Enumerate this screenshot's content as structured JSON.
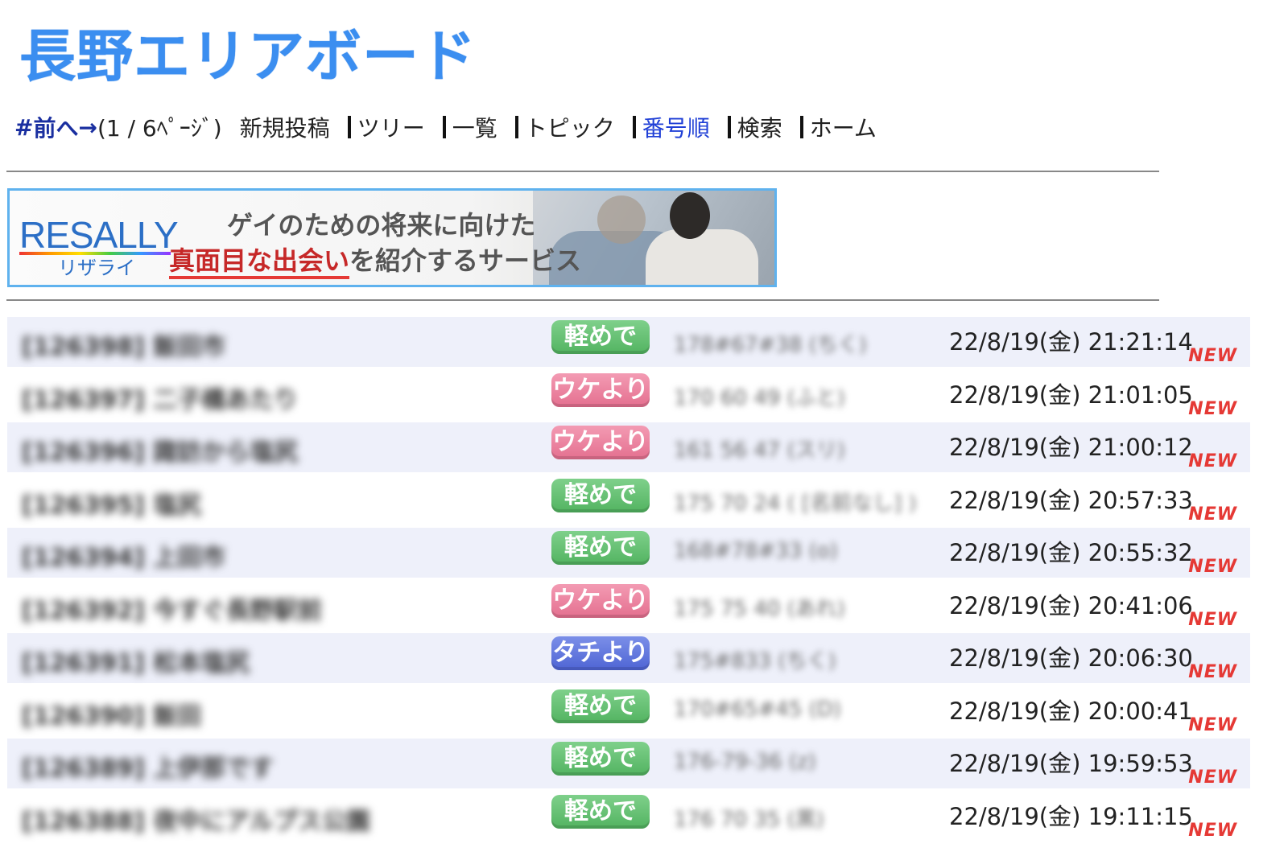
{
  "site": {
    "title": "長野エリアボード"
  },
  "nav": {
    "hash": "#",
    "prev": "前へ",
    "next": "→",
    "page_info": "(1 / 6ﾍﾟｰｼﾞ)",
    "items": [
      {
        "label": "新規投稿",
        "current": false
      },
      {
        "label": "ツリー",
        "current": false
      },
      {
        "label": "一覧",
        "current": false
      },
      {
        "label": "トピック",
        "current": false
      },
      {
        "label": "番号順",
        "current": true
      },
      {
        "label": "検索",
        "current": false
      },
      {
        "label": "ホーム",
        "current": false
      }
    ]
  },
  "banner": {
    "logo": "RESALLY",
    "logo_sub": "リザライ",
    "line1": "ゲイのための将来に向けた",
    "line2_highlight": "真面目な出会い",
    "line2_rest": "を紹介するサービス"
  },
  "posts": [
    {
      "title": "[126398] 飯田市",
      "badge": "軽めで",
      "badge_color": "green",
      "profile": "178#67#38 (ちく)",
      "date": "22/8/19(金) 21:21:14",
      "new": "NEW"
    },
    {
      "title": "[126397] 二子橋あたり",
      "badge": "ウケより",
      "badge_color": "pink",
      "profile": "170 60 49 (ふと)",
      "date": "22/8/19(金) 21:01:05",
      "new": "NEW"
    },
    {
      "title": "[126396] 諏訪から塩尻",
      "badge": "ウケより",
      "badge_color": "pink",
      "profile": "161 56 47 (スリ)",
      "date": "22/8/19(金) 21:00:12",
      "new": "NEW"
    },
    {
      "title": "[126395] 塩尻",
      "badge": "軽めで",
      "badge_color": "green",
      "profile": "175 70 24 ( [名前なし] )",
      "date": "22/8/19(金) 20:57:33",
      "new": "NEW"
    },
    {
      "title": "[126394] 上田市",
      "badge": "軽めで",
      "badge_color": "green",
      "profile": "168#78#33 (o)",
      "date": "22/8/19(金) 20:55:32",
      "new": "NEW"
    },
    {
      "title": "[126392] 今すぐ長野駅前",
      "badge": "ウケより",
      "badge_color": "pink",
      "profile": "175 75 40 (あれ)",
      "date": "22/8/19(金) 20:41:06",
      "new": "NEW"
    },
    {
      "title": "[126391] 松本塩尻",
      "badge": "タチより",
      "badge_color": "blue",
      "profile": "175#833 (ちく)",
      "date": "22/8/19(金) 20:06:30",
      "new": "NEW"
    },
    {
      "title": "[126390] 飯田",
      "badge": "軽めで",
      "badge_color": "green",
      "profile": "170#65#45 (D)",
      "date": "22/8/19(金) 20:00:41",
      "new": "NEW"
    },
    {
      "title": "[126389] 上伊那です",
      "badge": "軽めで",
      "badge_color": "green",
      "profile": "176-79-36 (z)",
      "date": "22/8/19(金) 19:59:53",
      "new": "NEW"
    },
    {
      "title": "[126388] 夜中にアルプス公園",
      "badge": "軽めで",
      "badge_color": "green",
      "profile": "176 70 35 (黒)",
      "date": "22/8/19(金) 19:11:15",
      "new": "NEW"
    }
  ]
}
